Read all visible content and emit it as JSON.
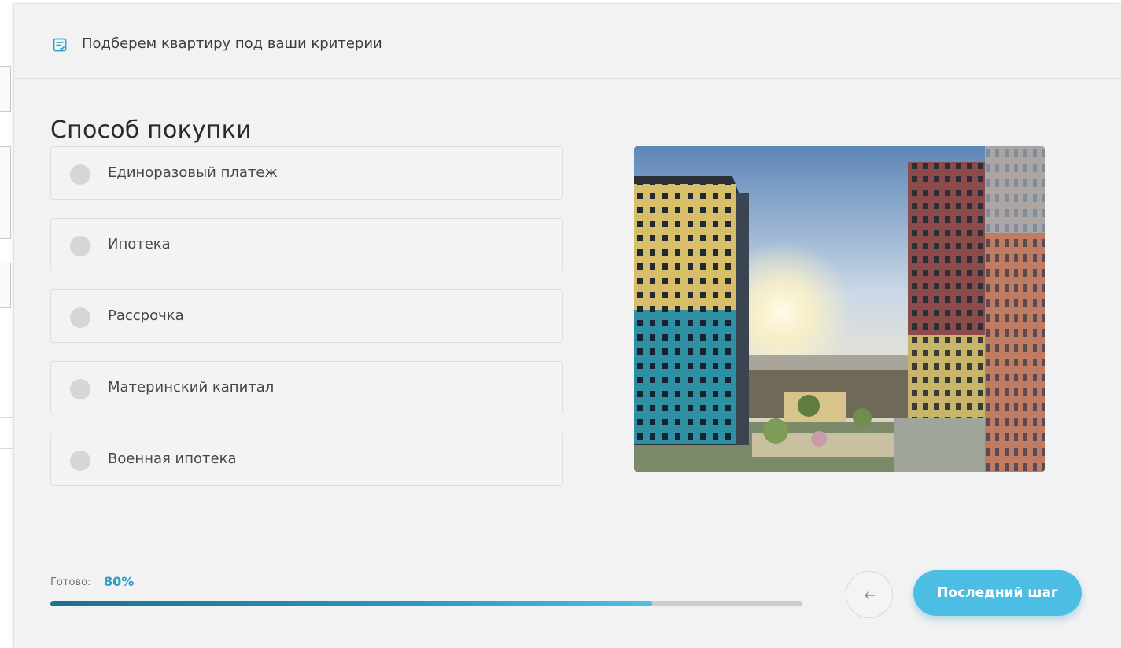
{
  "header": {
    "title": "Подберем квартиру под ваши критерии",
    "icon": "list-check-icon"
  },
  "step": {
    "title": "Способ покупки"
  },
  "options": [
    {
      "label": "Единоразовый платеж",
      "selected": false
    },
    {
      "label": "Ипотека",
      "selected": false
    },
    {
      "label": "Рассрочка",
      "selected": false
    },
    {
      "label": "Материнский капитал",
      "selected": false
    },
    {
      "label": "Военная ипотека",
      "selected": false
    }
  ],
  "image": {
    "subject": "residential-towers-photo"
  },
  "progress": {
    "label": "Готово:",
    "value_text": "80%",
    "percent": 80
  },
  "buttons": {
    "back_icon": "arrow-left-icon",
    "next_label": "Последний шаг"
  },
  "colors": {
    "accent": "#2a9ec8",
    "button": "#4cbde3",
    "modal_bg": "#f2f2f2",
    "radio": "#d6d6d6"
  }
}
